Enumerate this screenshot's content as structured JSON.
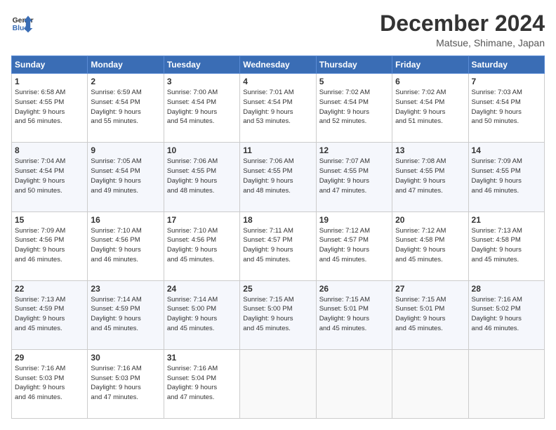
{
  "header": {
    "logo_line1": "General",
    "logo_line2": "Blue",
    "title": "December 2024",
    "subtitle": "Matsue, Shimane, Japan"
  },
  "weekdays": [
    "Sunday",
    "Monday",
    "Tuesday",
    "Wednesday",
    "Thursday",
    "Friday",
    "Saturday"
  ],
  "weeks": [
    [
      {
        "day": "1",
        "lines": [
          "Sunrise: 6:58 AM",
          "Sunset: 4:55 PM",
          "Daylight: 9 hours",
          "and 56 minutes."
        ]
      },
      {
        "day": "2",
        "lines": [
          "Sunrise: 6:59 AM",
          "Sunset: 4:54 PM",
          "Daylight: 9 hours",
          "and 55 minutes."
        ]
      },
      {
        "day": "3",
        "lines": [
          "Sunrise: 7:00 AM",
          "Sunset: 4:54 PM",
          "Daylight: 9 hours",
          "and 54 minutes."
        ]
      },
      {
        "day": "4",
        "lines": [
          "Sunrise: 7:01 AM",
          "Sunset: 4:54 PM",
          "Daylight: 9 hours",
          "and 53 minutes."
        ]
      },
      {
        "day": "5",
        "lines": [
          "Sunrise: 7:02 AM",
          "Sunset: 4:54 PM",
          "Daylight: 9 hours",
          "and 52 minutes."
        ]
      },
      {
        "day": "6",
        "lines": [
          "Sunrise: 7:02 AM",
          "Sunset: 4:54 PM",
          "Daylight: 9 hours",
          "and 51 minutes."
        ]
      },
      {
        "day": "7",
        "lines": [
          "Sunrise: 7:03 AM",
          "Sunset: 4:54 PM",
          "Daylight: 9 hours",
          "and 50 minutes."
        ]
      }
    ],
    [
      {
        "day": "8",
        "lines": [
          "Sunrise: 7:04 AM",
          "Sunset: 4:54 PM",
          "Daylight: 9 hours",
          "and 50 minutes."
        ]
      },
      {
        "day": "9",
        "lines": [
          "Sunrise: 7:05 AM",
          "Sunset: 4:54 PM",
          "Daylight: 9 hours",
          "and 49 minutes."
        ]
      },
      {
        "day": "10",
        "lines": [
          "Sunrise: 7:06 AM",
          "Sunset: 4:55 PM",
          "Daylight: 9 hours",
          "and 48 minutes."
        ]
      },
      {
        "day": "11",
        "lines": [
          "Sunrise: 7:06 AM",
          "Sunset: 4:55 PM",
          "Daylight: 9 hours",
          "and 48 minutes."
        ]
      },
      {
        "day": "12",
        "lines": [
          "Sunrise: 7:07 AM",
          "Sunset: 4:55 PM",
          "Daylight: 9 hours",
          "and 47 minutes."
        ]
      },
      {
        "day": "13",
        "lines": [
          "Sunrise: 7:08 AM",
          "Sunset: 4:55 PM",
          "Daylight: 9 hours",
          "and 47 minutes."
        ]
      },
      {
        "day": "14",
        "lines": [
          "Sunrise: 7:09 AM",
          "Sunset: 4:55 PM",
          "Daylight: 9 hours",
          "and 46 minutes."
        ]
      }
    ],
    [
      {
        "day": "15",
        "lines": [
          "Sunrise: 7:09 AM",
          "Sunset: 4:56 PM",
          "Daylight: 9 hours",
          "and 46 minutes."
        ]
      },
      {
        "day": "16",
        "lines": [
          "Sunrise: 7:10 AM",
          "Sunset: 4:56 PM",
          "Daylight: 9 hours",
          "and 46 minutes."
        ]
      },
      {
        "day": "17",
        "lines": [
          "Sunrise: 7:10 AM",
          "Sunset: 4:56 PM",
          "Daylight: 9 hours",
          "and 45 minutes."
        ]
      },
      {
        "day": "18",
        "lines": [
          "Sunrise: 7:11 AM",
          "Sunset: 4:57 PM",
          "Daylight: 9 hours",
          "and 45 minutes."
        ]
      },
      {
        "day": "19",
        "lines": [
          "Sunrise: 7:12 AM",
          "Sunset: 4:57 PM",
          "Daylight: 9 hours",
          "and 45 minutes."
        ]
      },
      {
        "day": "20",
        "lines": [
          "Sunrise: 7:12 AM",
          "Sunset: 4:58 PM",
          "Daylight: 9 hours",
          "and 45 minutes."
        ]
      },
      {
        "day": "21",
        "lines": [
          "Sunrise: 7:13 AM",
          "Sunset: 4:58 PM",
          "Daylight: 9 hours",
          "and 45 minutes."
        ]
      }
    ],
    [
      {
        "day": "22",
        "lines": [
          "Sunrise: 7:13 AM",
          "Sunset: 4:59 PM",
          "Daylight: 9 hours",
          "and 45 minutes."
        ]
      },
      {
        "day": "23",
        "lines": [
          "Sunrise: 7:14 AM",
          "Sunset: 4:59 PM",
          "Daylight: 9 hours",
          "and 45 minutes."
        ]
      },
      {
        "day": "24",
        "lines": [
          "Sunrise: 7:14 AM",
          "Sunset: 5:00 PM",
          "Daylight: 9 hours",
          "and 45 minutes."
        ]
      },
      {
        "day": "25",
        "lines": [
          "Sunrise: 7:15 AM",
          "Sunset: 5:00 PM",
          "Daylight: 9 hours",
          "and 45 minutes."
        ]
      },
      {
        "day": "26",
        "lines": [
          "Sunrise: 7:15 AM",
          "Sunset: 5:01 PM",
          "Daylight: 9 hours",
          "and 45 minutes."
        ]
      },
      {
        "day": "27",
        "lines": [
          "Sunrise: 7:15 AM",
          "Sunset: 5:01 PM",
          "Daylight: 9 hours",
          "and 45 minutes."
        ]
      },
      {
        "day": "28",
        "lines": [
          "Sunrise: 7:16 AM",
          "Sunset: 5:02 PM",
          "Daylight: 9 hours",
          "and 46 minutes."
        ]
      }
    ],
    [
      {
        "day": "29",
        "lines": [
          "Sunrise: 7:16 AM",
          "Sunset: 5:03 PM",
          "Daylight: 9 hours",
          "and 46 minutes."
        ]
      },
      {
        "day": "30",
        "lines": [
          "Sunrise: 7:16 AM",
          "Sunset: 5:03 PM",
          "Daylight: 9 hours",
          "and 47 minutes."
        ]
      },
      {
        "day": "31",
        "lines": [
          "Sunrise: 7:16 AM",
          "Sunset: 5:04 PM",
          "Daylight: 9 hours",
          "and 47 minutes."
        ]
      },
      null,
      null,
      null,
      null
    ]
  ]
}
